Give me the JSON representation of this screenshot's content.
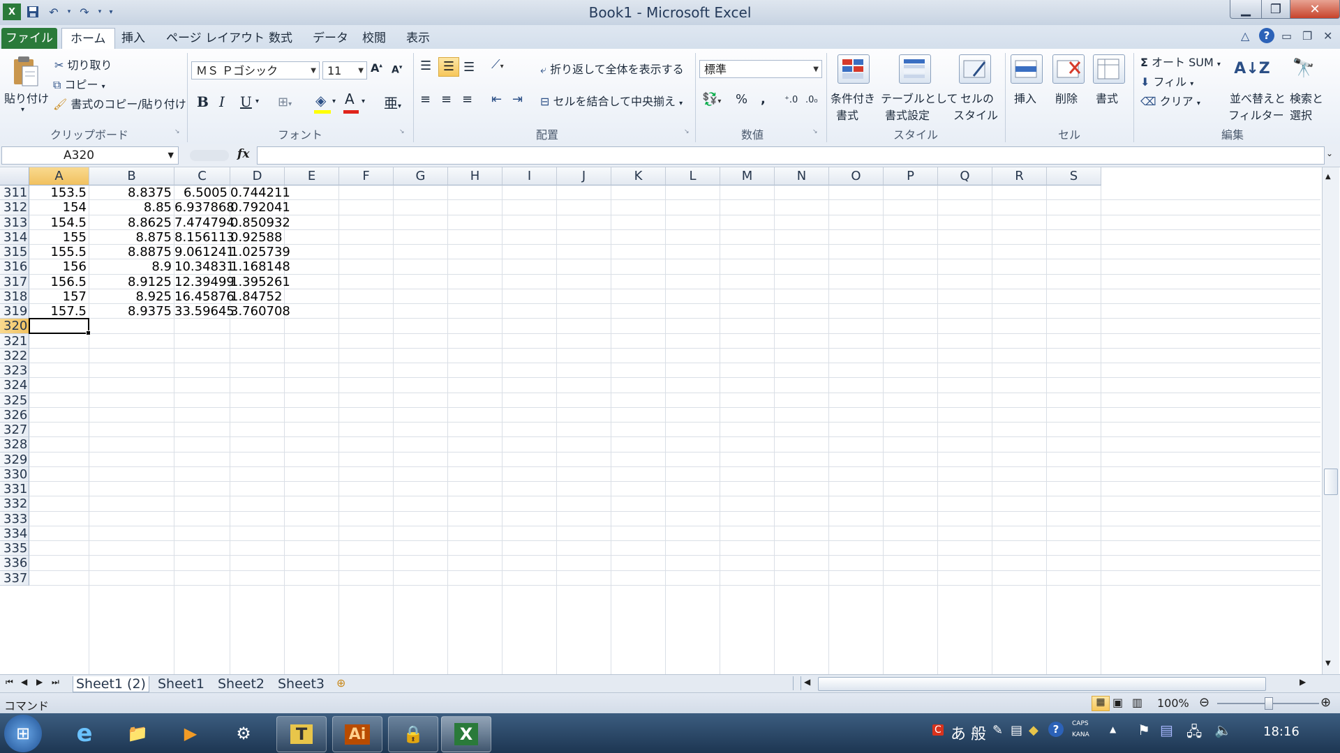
{
  "window": {
    "title": "Book1 - Microsoft Excel"
  },
  "tabs": [
    "ファイル",
    "ホーム",
    "挿入",
    "ページ レイアウト",
    "数式",
    "データ",
    "校閲",
    "表示"
  ],
  "ribbon": {
    "clipboard": {
      "paste": "貼り付け",
      "cut": "切り取り",
      "copy": "コピー",
      "format_painter": "書式のコピー/貼り付け",
      "group": "クリップボード"
    },
    "font": {
      "name": "ＭＳ Ｐゴシック",
      "size": "11",
      "group": "フォント"
    },
    "alignment": {
      "wrap": "折り返して全体を表示する",
      "merge": "セルを結合して中央揃え",
      "group": "配置"
    },
    "number": {
      "format": "標準",
      "group": "数値"
    },
    "styles": {
      "conditional": [
        "条件付き",
        "書式"
      ],
      "table": [
        "テーブルとして",
        "書式設定"
      ],
      "cellstyle": [
        "セルの",
        "スタイル"
      ],
      "group": "スタイル"
    },
    "cells": {
      "insert": "挿入",
      "delete": "削除",
      "format": "書式",
      "group": "セル"
    },
    "editing": {
      "autosum": "オート SUM",
      "fill": "フィル",
      "clear": "クリア",
      "sort": [
        "並べ替えと",
        "フィルター"
      ],
      "find": [
        "検索と",
        "選択"
      ],
      "group": "編集"
    }
  },
  "formula_bar": {
    "name_box": "A320",
    "fx": "fx"
  },
  "columns": [
    "A",
    "B",
    "C",
    "D",
    "E",
    "F",
    "G",
    "H",
    "I",
    "J",
    "K",
    "L",
    "M",
    "N",
    "O",
    "P",
    "Q",
    "R",
    "S"
  ],
  "rows": [
    {
      "n": "311",
      "a": "153.5",
      "b": "8.8375",
      "c": "6.5005",
      "d": "0.744211"
    },
    {
      "n": "312",
      "a": "154",
      "b": "8.85",
      "c": "6.937868",
      "d": "0.792041"
    },
    {
      "n": "313",
      "a": "154.5",
      "b": "8.8625",
      "c": "7.474794",
      "d": "0.850932"
    },
    {
      "n": "314",
      "a": "155",
      "b": "8.875",
      "c": "8.156113",
      "d": "0.92588"
    },
    {
      "n": "315",
      "a": "155.5",
      "b": "8.8875",
      "c": "9.061241",
      "d": "1.025739"
    },
    {
      "n": "316",
      "a": "156",
      "b": "8.9",
      "c": "10.34831",
      "d": "1.168148"
    },
    {
      "n": "317",
      "a": "156.5",
      "b": "8.9125",
      "c": "12.39499",
      "d": "1.395261"
    },
    {
      "n": "318",
      "a": "157",
      "b": "8.925",
      "c": "16.45876",
      "d": "1.84752"
    },
    {
      "n": "319",
      "a": "157.5",
      "b": "8.9375",
      "c": "33.59645",
      "d": "3.760708"
    },
    {
      "n": "320",
      "a": "",
      "b": "",
      "c": "",
      "d": ""
    },
    {
      "n": "321",
      "a": "",
      "b": "",
      "c": "",
      "d": ""
    },
    {
      "n": "322",
      "a": "",
      "b": "",
      "c": "",
      "d": ""
    },
    {
      "n": "323",
      "a": "",
      "b": "",
      "c": "",
      "d": ""
    },
    {
      "n": "324",
      "a": "",
      "b": "",
      "c": "",
      "d": ""
    },
    {
      "n": "325",
      "a": "",
      "b": "",
      "c": "",
      "d": ""
    },
    {
      "n": "326",
      "a": "",
      "b": "",
      "c": "",
      "d": ""
    },
    {
      "n": "327",
      "a": "",
      "b": "",
      "c": "",
      "d": ""
    },
    {
      "n": "328",
      "a": "",
      "b": "",
      "c": "",
      "d": ""
    },
    {
      "n": "329",
      "a": "",
      "b": "",
      "c": "",
      "d": ""
    },
    {
      "n": "330",
      "a": "",
      "b": "",
      "c": "",
      "d": ""
    },
    {
      "n": "331",
      "a": "",
      "b": "",
      "c": "",
      "d": ""
    },
    {
      "n": "332",
      "a": "",
      "b": "",
      "c": "",
      "d": ""
    },
    {
      "n": "333",
      "a": "",
      "b": "",
      "c": "",
      "d": ""
    },
    {
      "n": "334",
      "a": "",
      "b": "",
      "c": "",
      "d": ""
    },
    {
      "n": "335",
      "a": "",
      "b": "",
      "c": "",
      "d": ""
    },
    {
      "n": "336",
      "a": "",
      "b": "",
      "c": "",
      "d": ""
    },
    {
      "n": "337",
      "a": "",
      "b": "",
      "c": "",
      "d": ""
    }
  ],
  "sheets": [
    "Sheet1 (2)",
    "Sheet1",
    "Sheet2",
    "Sheet3"
  ],
  "status": {
    "mode": "コマンド",
    "zoom": "100%"
  },
  "taskbar": {
    "clock": "18:16",
    "ime": "あ 般",
    "caps": "CAPS",
    "kana": "KANA"
  },
  "colors": {
    "file_tab": "#2a7a3a",
    "active_header": "#f1c15f",
    "taskbar": "#1d3652"
  }
}
